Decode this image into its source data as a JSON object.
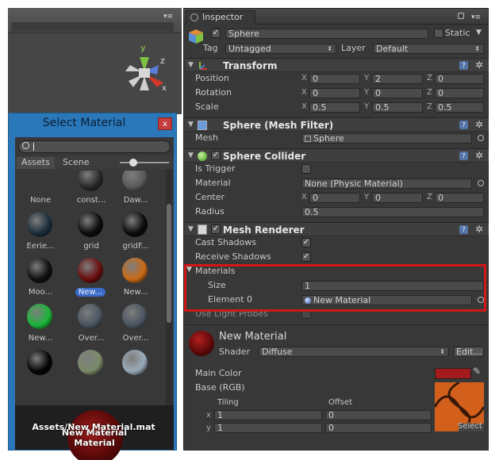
{
  "select_window": {
    "title": "Select Material",
    "close": "x",
    "search_value": "",
    "tabs": [
      "Assets",
      "Scene"
    ],
    "items": [
      {
        "name": "None",
        "color": "#383838"
      },
      {
        "name": "const...",
        "color": "#2a2a2a"
      },
      {
        "name": "Daw...",
        "color": "#5a5a5a"
      },
      {
        "name": "Eerie...",
        "color": "#1c2f3c"
      },
      {
        "name": "grid",
        "color": "#0c0c0c"
      },
      {
        "name": "gridF...",
        "color": "#0c0c0c"
      },
      {
        "name": "Moo...",
        "color": "#101010"
      },
      {
        "name": "New...",
        "color": "#6a0d0d",
        "selected": true
      },
      {
        "name": "New...",
        "color": "#c96a18"
      },
      {
        "name": "New...",
        "color": "#1bb53a"
      },
      {
        "name": "Over...",
        "color": "#4a5560"
      },
      {
        "name": "Over...",
        "color": "#4a5560"
      },
      {
        "name": "",
        "color": "#050505"
      },
      {
        "name": "",
        "color": "#7a8a6a"
      },
      {
        "name": "",
        "color": "#9aaab8"
      }
    ],
    "preview": {
      "line1": "New Material",
      "line2": "Material",
      "line3": "Assets/New Material.mat"
    }
  },
  "inspector": {
    "tab": "Inspector",
    "object": {
      "active": "✓",
      "name": "Sphere",
      "static_label": "Static",
      "tag_label": "Tag",
      "tag": "Untagged",
      "layer_label": "Layer",
      "layer": "Default"
    },
    "transform": {
      "title": "Transform",
      "position": {
        "label": "Position",
        "x": "0",
        "y": "2",
        "z": "0"
      },
      "rotation": {
        "label": "Rotation",
        "x": "0",
        "y": "0",
        "z": "0"
      },
      "scale": {
        "label": "Scale",
        "x": "0.5",
        "y": "0.5",
        "z": "0.5"
      }
    },
    "mesh_filter": {
      "title": "Sphere (Mesh Filter)",
      "mesh_label": "Mesh",
      "mesh": "Sphere"
    },
    "collider": {
      "title": "Sphere Collider",
      "is_trigger_label": "Is Trigger",
      "material_label": "Material",
      "material": "None (Physic Material)",
      "center_label": "Center",
      "center": {
        "x": "0",
        "y": "0",
        "z": "0"
      },
      "radius_label": "Radius",
      "radius": "0.5"
    },
    "renderer": {
      "title": "Mesh Renderer",
      "cast_shadows_label": "Cast Shadows",
      "receive_shadows_label": "Receive Shadows",
      "materials_label": "Materials",
      "size_label": "Size",
      "size": "1",
      "element_label": "Element 0",
      "element": "New Material",
      "light_probes_label": "Use Light Probes"
    },
    "material": {
      "name": "New Material",
      "shader_label": "Shader",
      "shader": "Diffuse",
      "edit": "Edit...",
      "main_color_label": "Main Color",
      "main_color": "#a51b1b",
      "base_label": "Base (RGB)",
      "tiling_label": "Tiling",
      "offset_label": "Offset",
      "tiling_x": "1",
      "tiling_y": "1",
      "offset_x": "0",
      "offset_y": "0",
      "select": "Select"
    }
  },
  "axes": {
    "x": "X",
    "y": "Y",
    "z": "Z"
  },
  "gizmo": {
    "y": "y",
    "z": "z",
    "x": "x"
  }
}
